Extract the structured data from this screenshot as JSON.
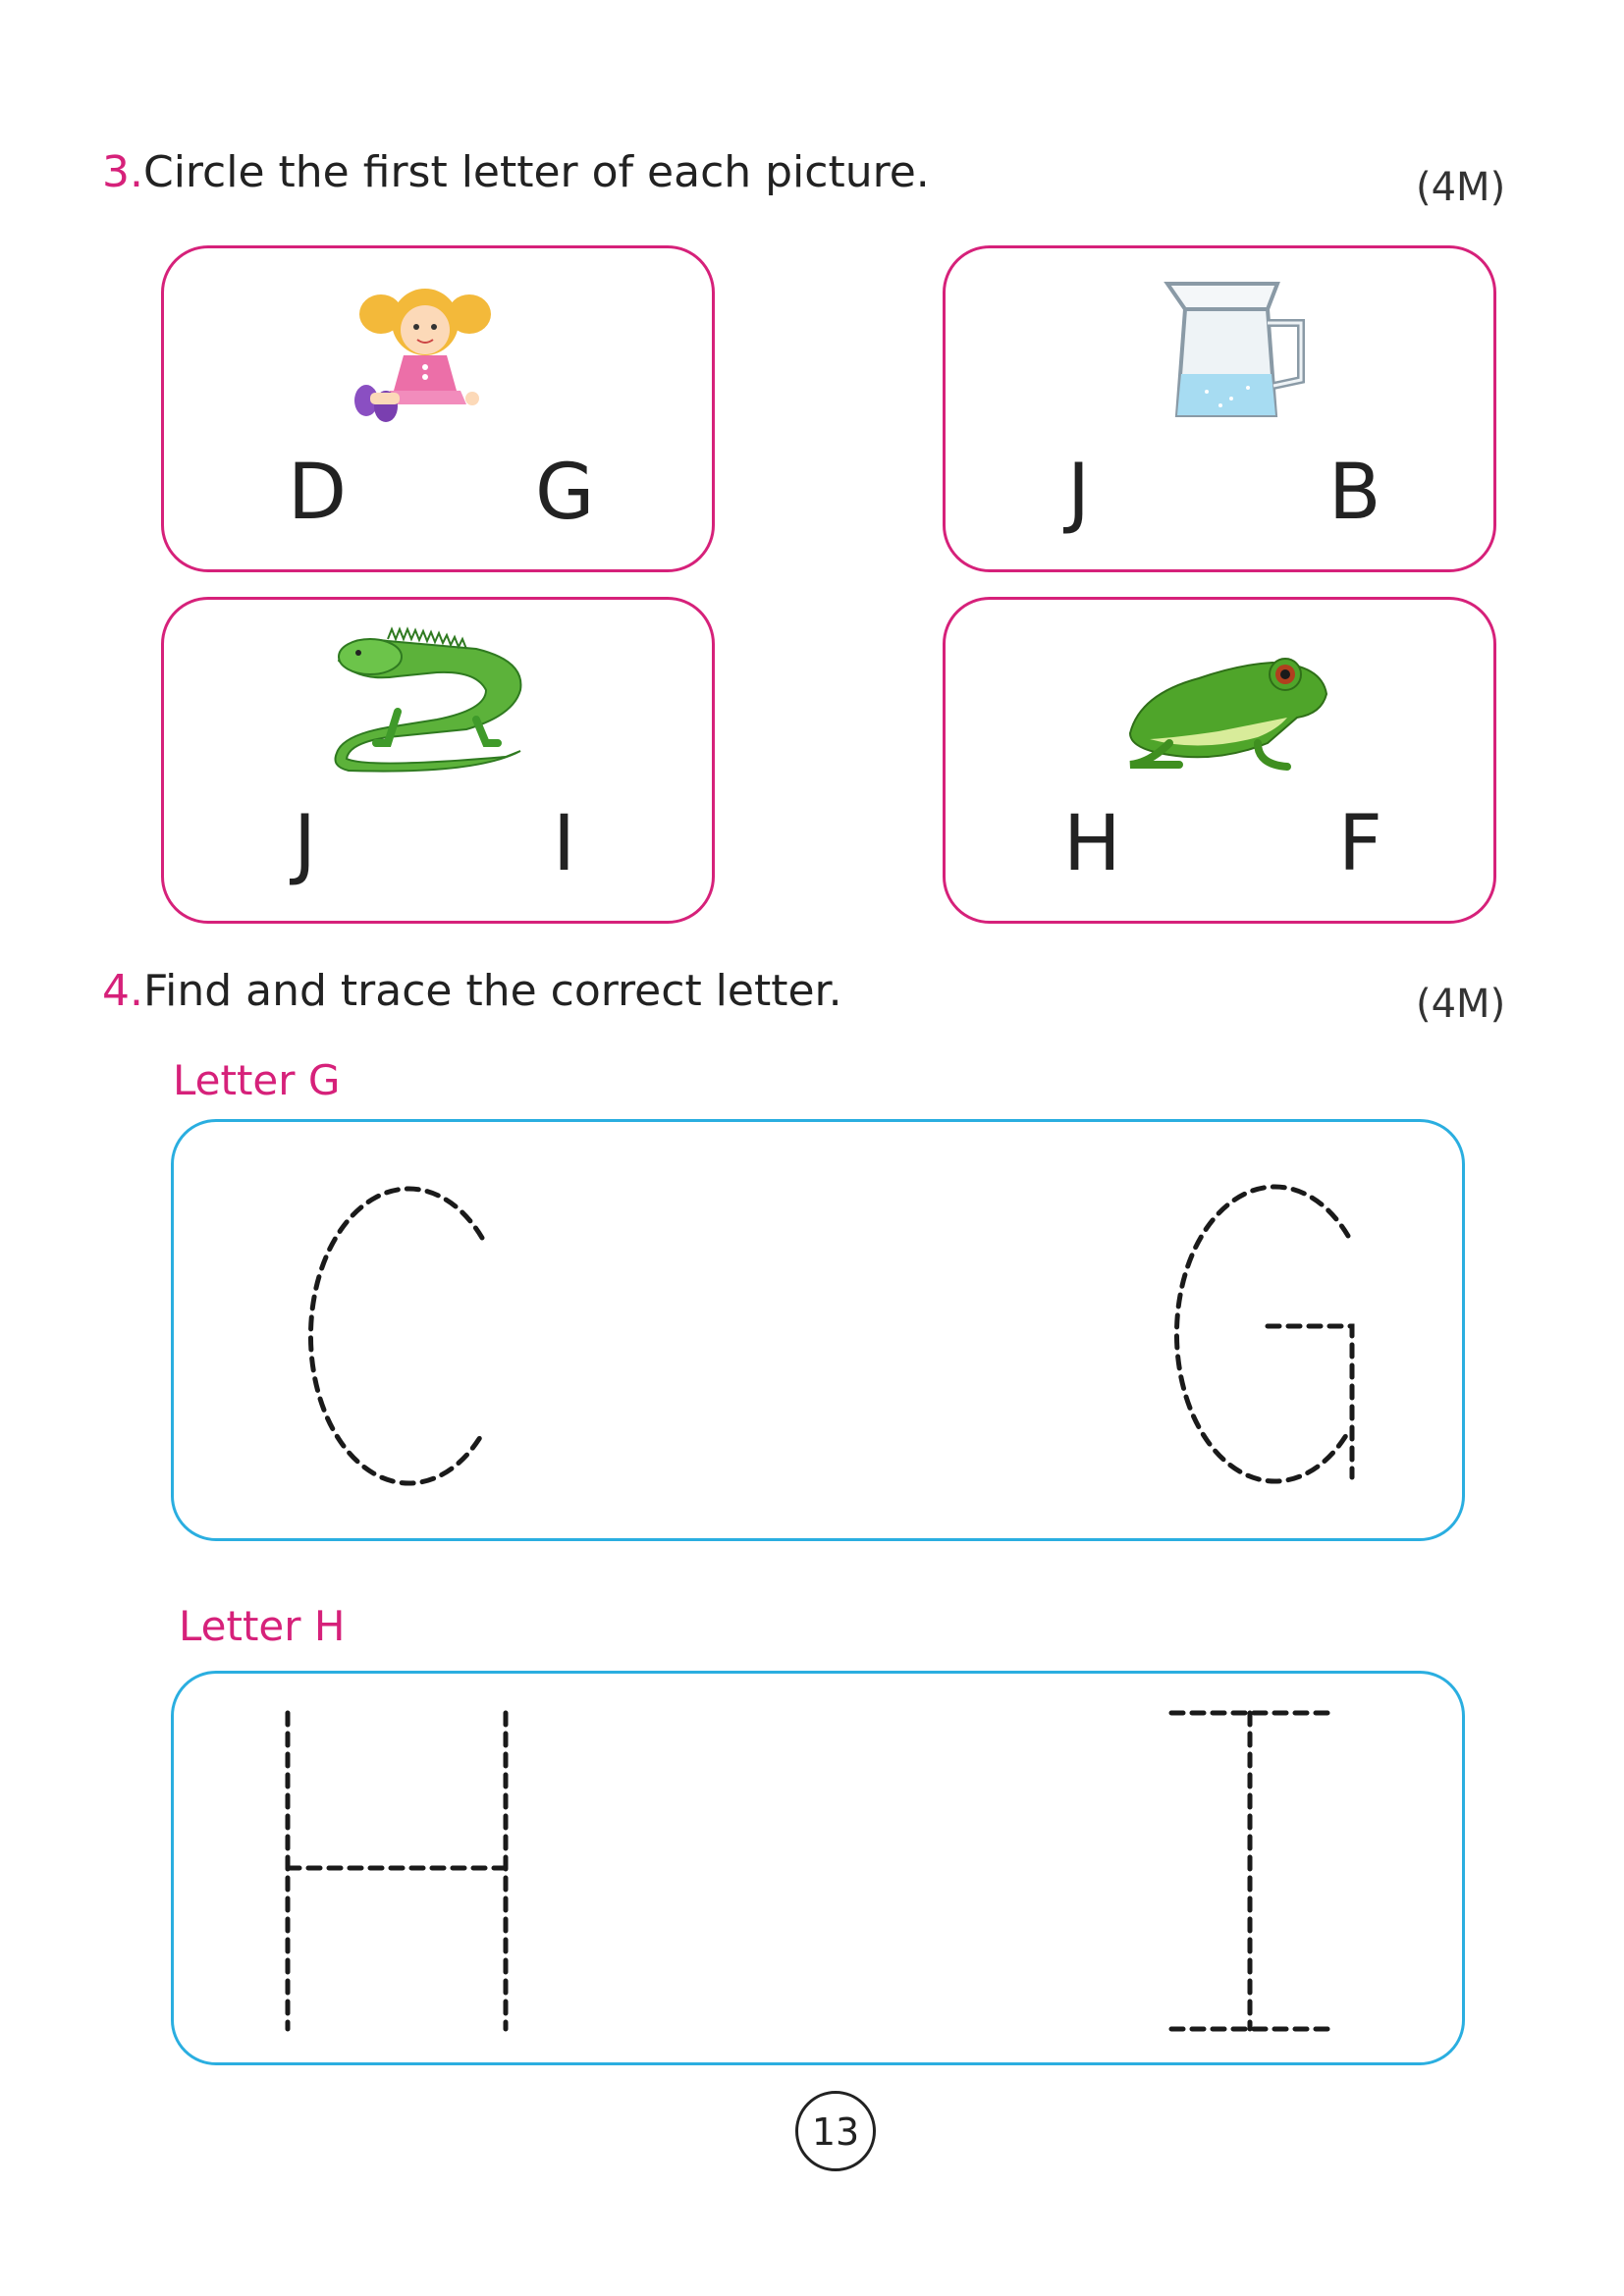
{
  "question3": {
    "number": "3.",
    "text": "Circle the first letter of each picture.",
    "marks": "(4M)",
    "cards": [
      {
        "picture": "doll",
        "options": [
          "D",
          "G"
        ]
      },
      {
        "picture": "jug",
        "options": [
          "J",
          "B"
        ]
      },
      {
        "picture": "iguana",
        "options": [
          "J",
          "I"
        ]
      },
      {
        "picture": "frog",
        "options": [
          "H",
          "F"
        ]
      }
    ]
  },
  "question4": {
    "number": "4.",
    "text": "Find and trace the correct letter.",
    "marks": "(4M)",
    "groups": [
      {
        "label": "Letter G",
        "traced_letters": [
          "C",
          "G"
        ]
      },
      {
        "label": "Letter H",
        "traced_letters": [
          "H",
          "I"
        ]
      }
    ]
  },
  "page_number": "13",
  "colors": {
    "accent": "#d6217a",
    "trace_border": "#2aaee0"
  }
}
